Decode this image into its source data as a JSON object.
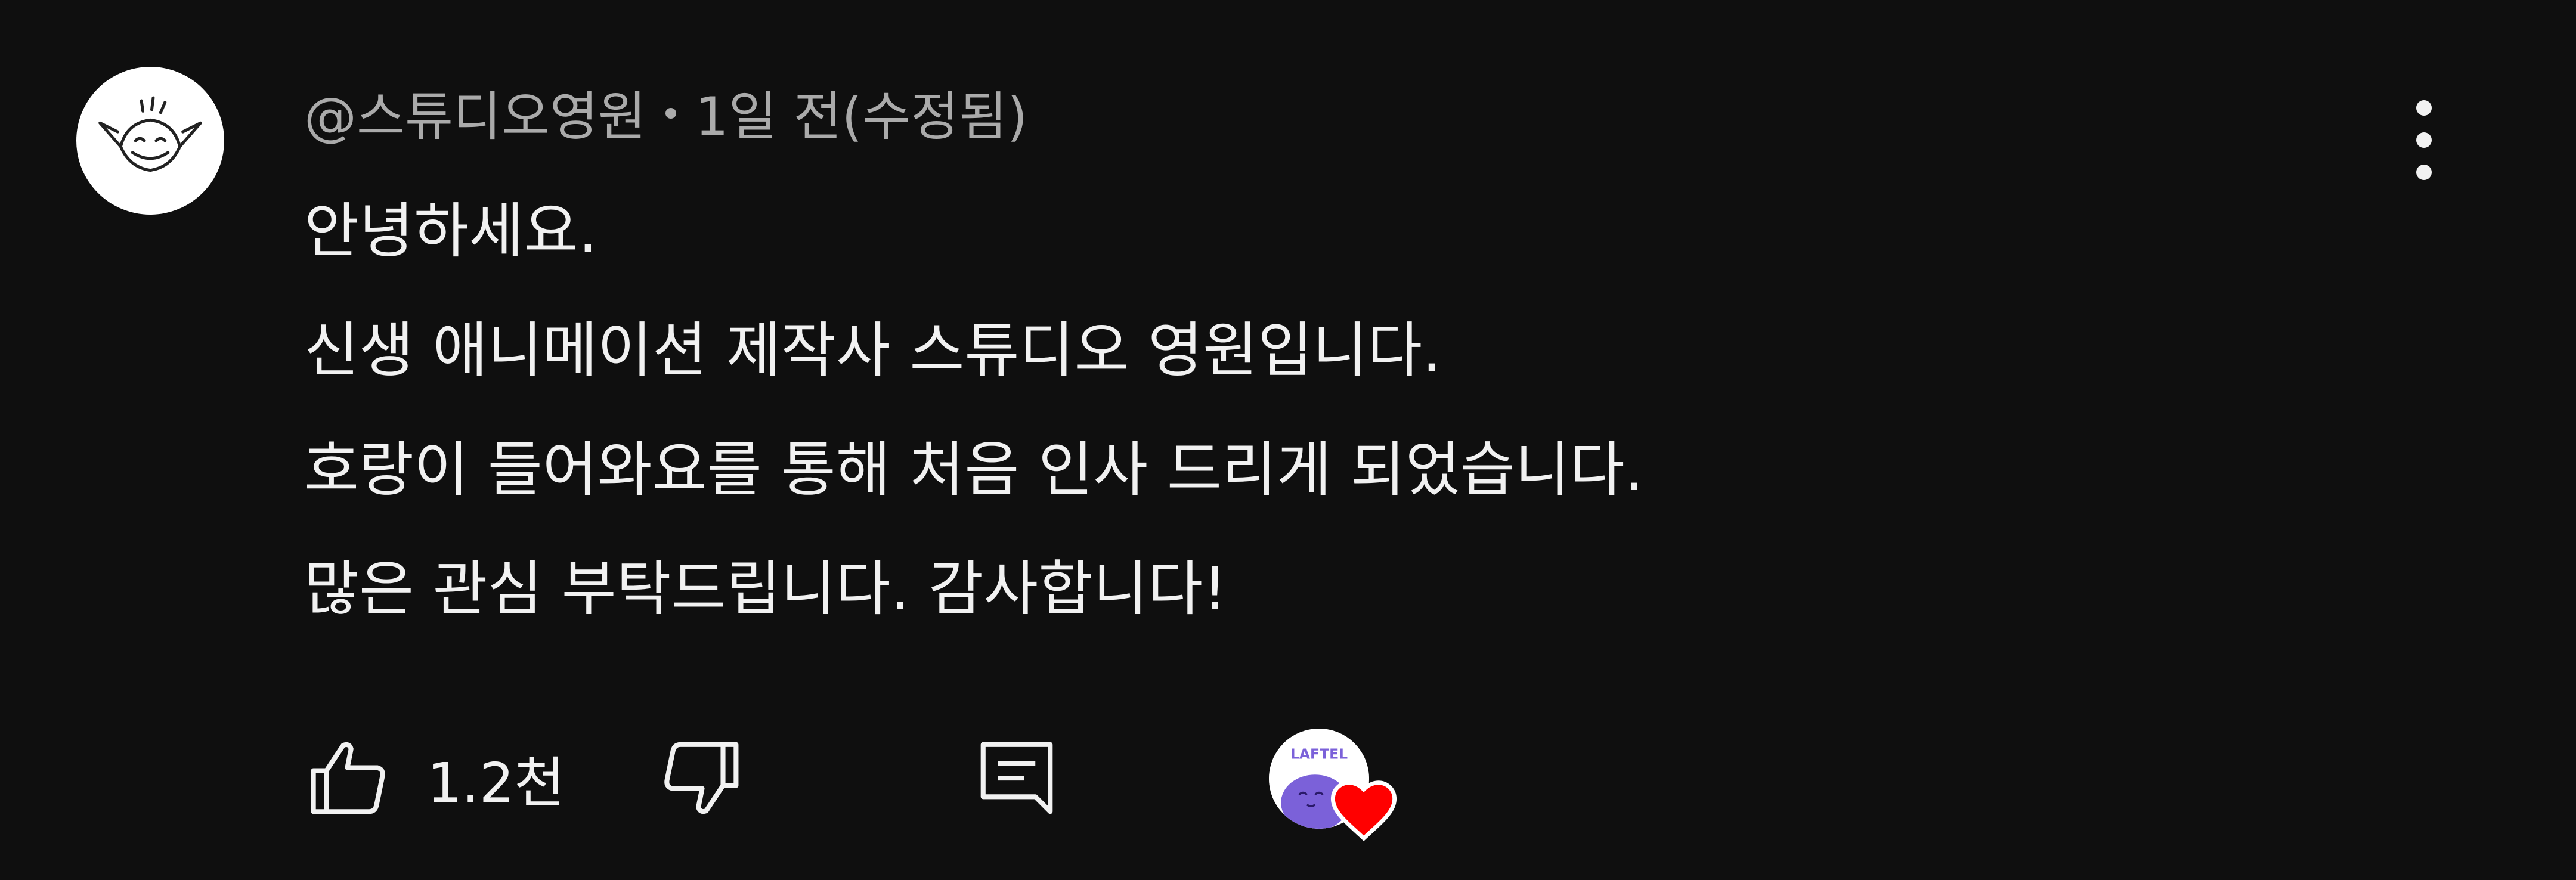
{
  "comment": {
    "author": "@스튜디오영원",
    "time": "1일 전",
    "edited": "(수정됨)",
    "lines": [
      "안녕하세요.",
      "신생 애니메이션 제작사 스튜디오 영원입니다.",
      "호랑이 들어와요를 통해 처음 인사 드리게 되었습니다.",
      "많은 관심 부탁드립니다. 감사합니다!"
    ]
  },
  "actions": {
    "like_count": "1.2천",
    "creator_badge_text": "LAFTEL"
  },
  "icons": {
    "avatar": "goblin-avatar-icon",
    "menu": "more-vert-icon",
    "like": "thumbs-up-icon",
    "dislike": "thumbs-down-icon",
    "reply": "comment-icon",
    "creator": "laftel-creator-avatar",
    "heart": "heart-icon"
  },
  "colors": {
    "background": "#0f0f0f",
    "text_primary": "#f1f1f1",
    "text_secondary": "#aaaaaa",
    "heart": "#ff0000",
    "laftel_purple": "#7b61d9"
  }
}
